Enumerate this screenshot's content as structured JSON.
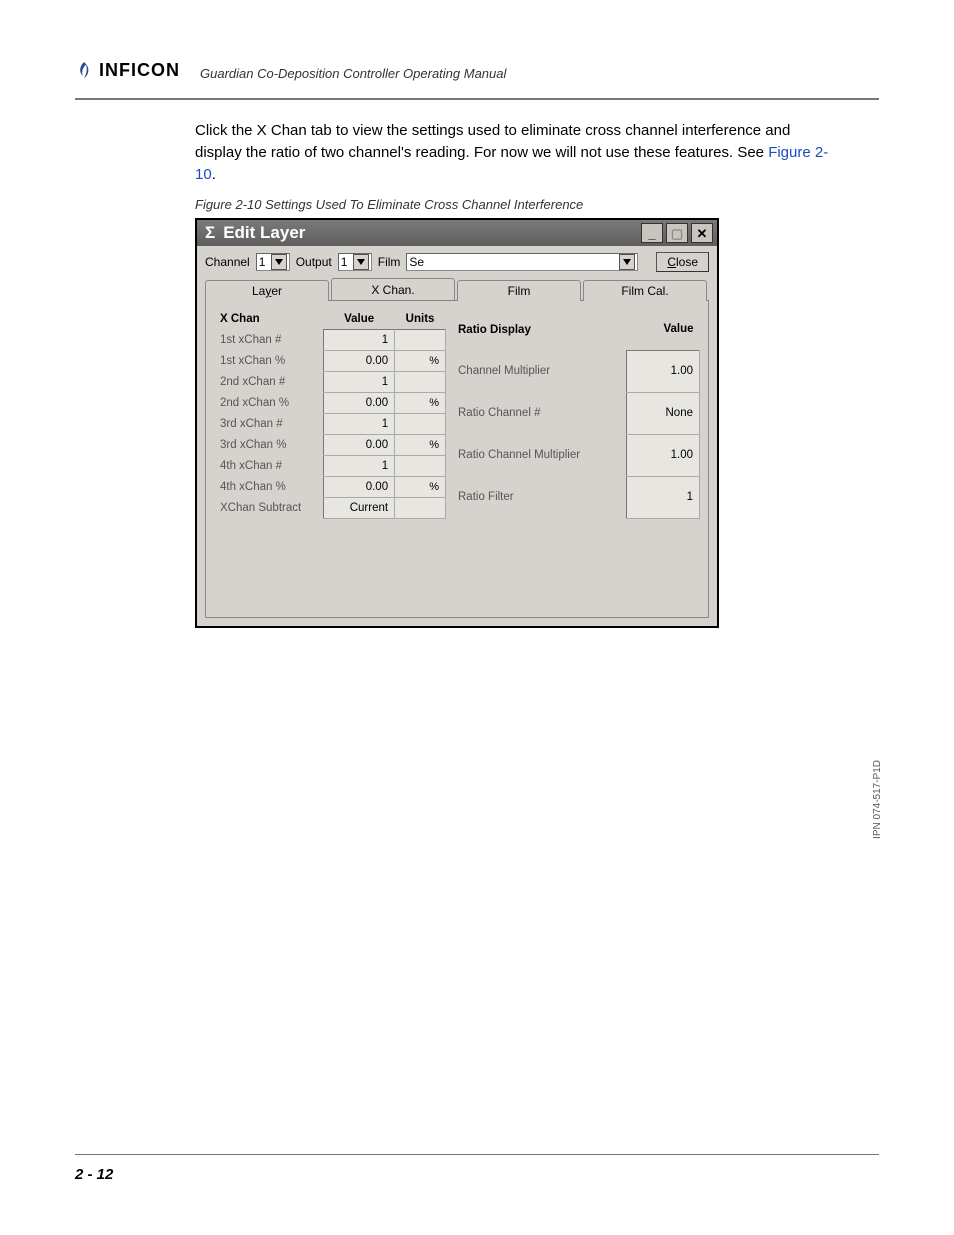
{
  "header": {
    "brand": "INFICON",
    "manual_title": "Guardian Co-Deposition Controller Operating Manual"
  },
  "body": {
    "paragraph_a": "Click the X Chan tab to view the settings used to eliminate cross channel interference and display the ratio of two channel's reading. For now we will not use these features. See ",
    "figure_link": "Figure 2-10",
    "paragraph_b": "."
  },
  "figure_caption": "Figure 2-10  Settings Used To Eliminate Cross Channel Interference",
  "window": {
    "icon": "Σ",
    "title": "Edit Layer",
    "toolbar": {
      "channel_label": "Channel",
      "channel_value": "1",
      "output_label": "Output",
      "output_value": "1",
      "film_label": "Film",
      "film_value": "Se",
      "close_label": "Close"
    },
    "tabs": {
      "layer": "Layer",
      "xchan": "X Chan.",
      "film": "Film",
      "filmcal": "Film Cal."
    },
    "left_table": {
      "headers": [
        "X Chan",
        "Value",
        "Units"
      ],
      "rows": [
        {
          "label": "1st xChan #",
          "value": "1",
          "unit": ""
        },
        {
          "label": "1st xChan %",
          "value": "0.00",
          "unit": "%"
        },
        {
          "label": "2nd xChan #",
          "value": "1",
          "unit": ""
        },
        {
          "label": "2nd xChan %",
          "value": "0.00",
          "unit": "%"
        },
        {
          "label": "3rd xChan #",
          "value": "1",
          "unit": ""
        },
        {
          "label": "3rd xChan %",
          "value": "0.00",
          "unit": "%"
        },
        {
          "label": "4th xChan #",
          "value": "1",
          "unit": ""
        },
        {
          "label": "4th xChan %",
          "value": "0.00",
          "unit": "%"
        },
        {
          "label": "XChan Subtract",
          "value": "Current",
          "unit": ""
        }
      ]
    },
    "right_table": {
      "headers": [
        "Ratio Display",
        "Value"
      ],
      "rows": [
        {
          "label": "Channel Multiplier",
          "value": "1.00"
        },
        {
          "label": "Ratio Channel #",
          "value": "None"
        },
        {
          "label": "Ratio Channel Multiplier",
          "value": "1.00"
        },
        {
          "label": "Ratio Filter",
          "value": "1"
        }
      ]
    }
  },
  "side_label": "IPN 074-517-P1D",
  "footer": {
    "page": "2 - 12"
  }
}
